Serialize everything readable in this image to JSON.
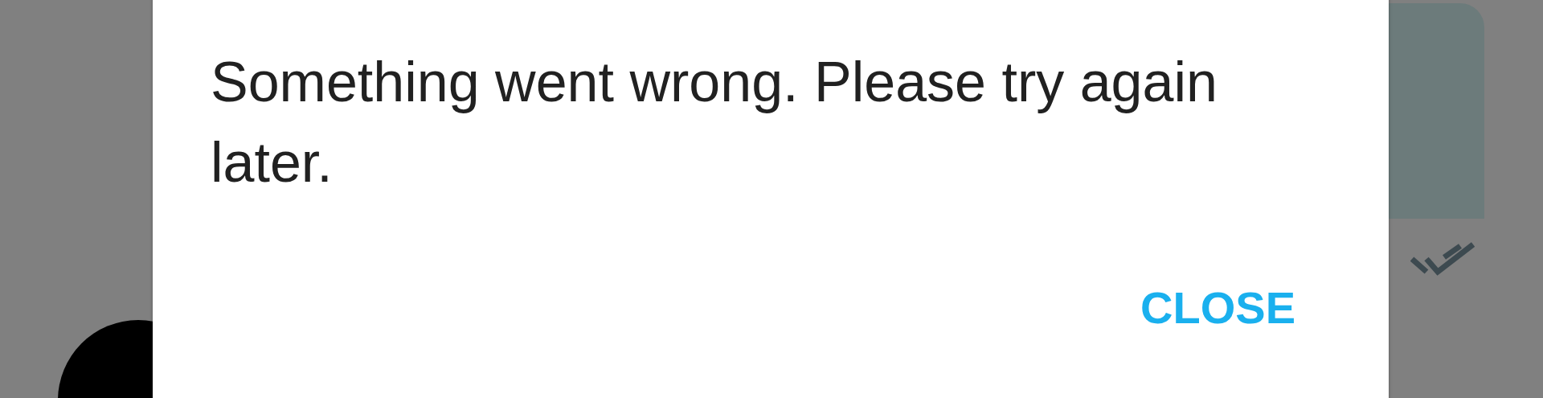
{
  "background_chat": {
    "read": true
  },
  "dialog": {
    "message": "Something went wrong. Please try again later.",
    "buttons": [
      "CLOSE"
    ]
  }
}
